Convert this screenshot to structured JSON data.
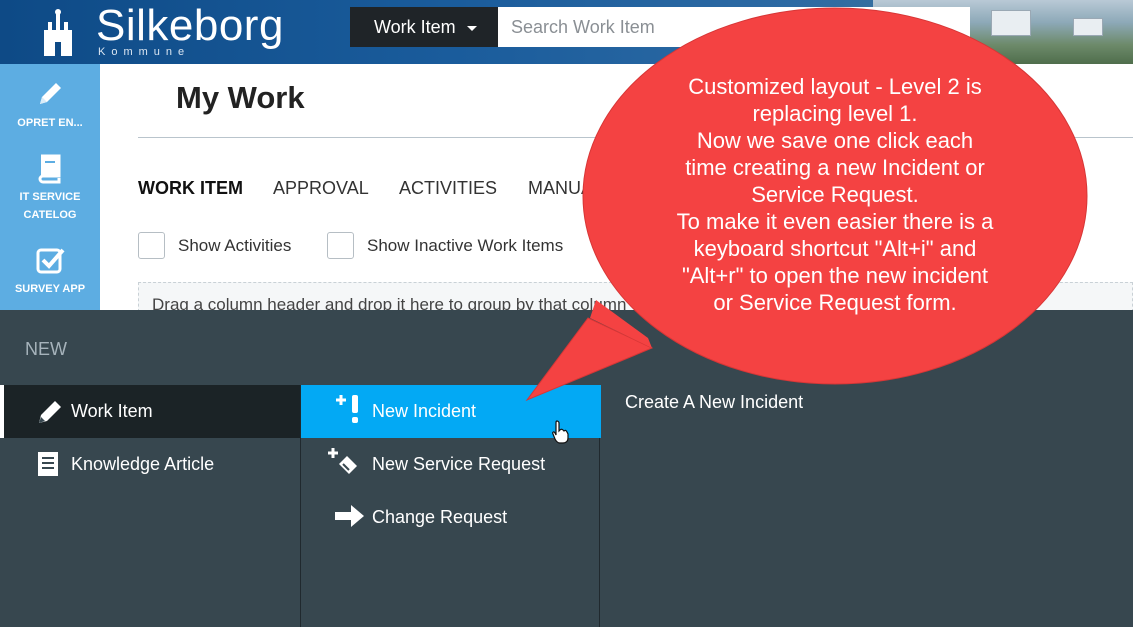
{
  "brand": {
    "name": "Silkeborg",
    "sub": "Kommune"
  },
  "header": {
    "dropdown_label": "Work Item",
    "search_placeholder": "Search Work Item"
  },
  "sidebar": {
    "items": [
      {
        "label": "OPRET EN...",
        "icon": "pencil-icon"
      },
      {
        "label": "IT SERVICE",
        "label2": "CATELOG",
        "icon": "book-icon"
      },
      {
        "label": "SURVEY APP",
        "icon": "checkbox-icon"
      }
    ]
  },
  "main": {
    "title": "My Work",
    "tabs": [
      "WORK ITEM",
      "APPROVAL",
      "ACTIVITIES",
      "MANUA"
    ],
    "checkboxes": [
      "Show Activities",
      "Show Inactive Work Items"
    ],
    "group_hint": "Drag a column header and drop it here to group by that column"
  },
  "drawer": {
    "title": "NEW",
    "level1": [
      {
        "label": "Work Item",
        "icon": "pencil-icon"
      },
      {
        "label": "Knowledge Article",
        "icon": "document-icon"
      }
    ],
    "level2": [
      {
        "label": "New Incident",
        "icon": "plus-exclamation-icon"
      },
      {
        "label": "New Service Request",
        "icon": "plus-ticket-icon"
      },
      {
        "label": "Change Request",
        "icon": "arrow-right-icon"
      }
    ],
    "description": "Create A New Incident"
  },
  "callout": {
    "lines": [
      "Customized layout - Level 2 is",
      "replacing level 1.",
      "Now we save one click each",
      "time creating a new Incident or",
      "Service Request.",
      "To make it even easier there is a",
      "keyboard shortcut \"Alt+i\" and",
      "\"Alt+r\" to open the new incident",
      "or Service Request form."
    ]
  },
  "colors": {
    "header_blue": "#0e4a86",
    "sidebar_blue": "#5dade2",
    "drawer_bg": "#37474f",
    "active_item": "#03a9f4",
    "callout_red": "#f44242"
  }
}
